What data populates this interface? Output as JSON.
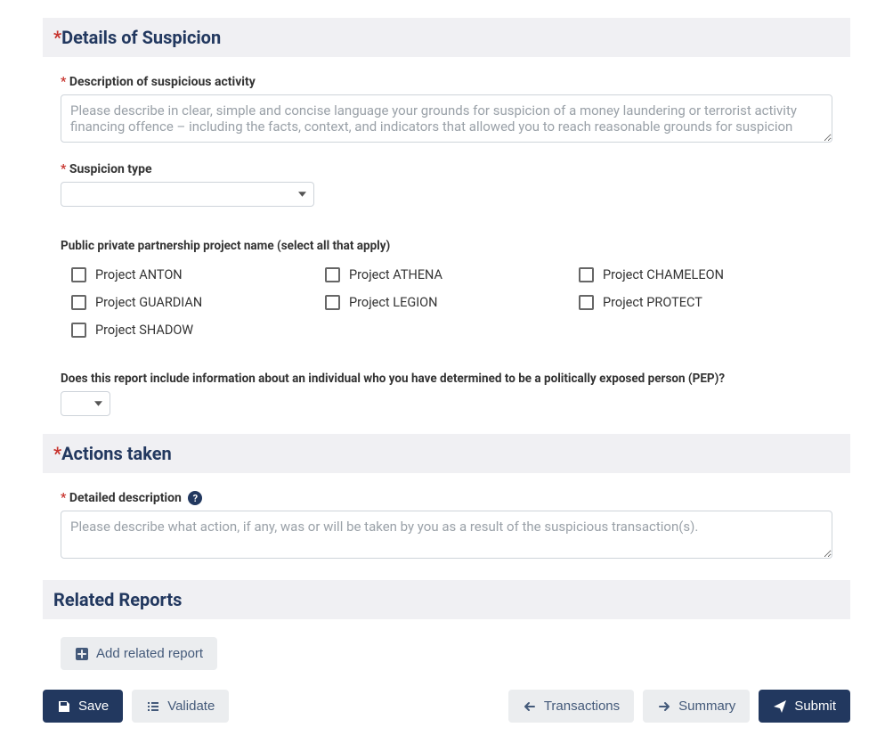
{
  "sections": {
    "suspicion": {
      "title": "Details of Suspicion"
    },
    "actions": {
      "title": "Actions taken"
    },
    "related": {
      "title": "Related Reports"
    }
  },
  "desc": {
    "label": "Description of suspicious activity",
    "placeholder": "Please describe in clear, simple and concise language your grounds for suspicion of a money laundering or terrorist activity financing offence – including the facts, context, and indicators that allowed you to reach reasonable grounds for suspicion"
  },
  "stype": {
    "label": "Suspicion type"
  },
  "ppp": {
    "label": "Public private partnership project name (select all that apply)",
    "items": [
      "Project ANTON",
      "Project ATHENA",
      "Project CHAMELEON",
      "Project GUARDIAN",
      "Project LEGION",
      "Project PROTECT",
      "Project SHADOW"
    ]
  },
  "pep": {
    "label": "Does this report include information about an individual who you have determined to be a politically exposed person (PEP)?"
  },
  "actdesc": {
    "label": "Detailed description",
    "placeholder": "Please describe what action, if any, was or will be taken by you as a result of the suspicious transaction(s)."
  },
  "buttons": {
    "add_related": "Add related report",
    "save": "Save",
    "validate": "Validate",
    "transactions": "Transactions",
    "summary": "Summary",
    "submit": "Submit"
  },
  "help_q": "?"
}
